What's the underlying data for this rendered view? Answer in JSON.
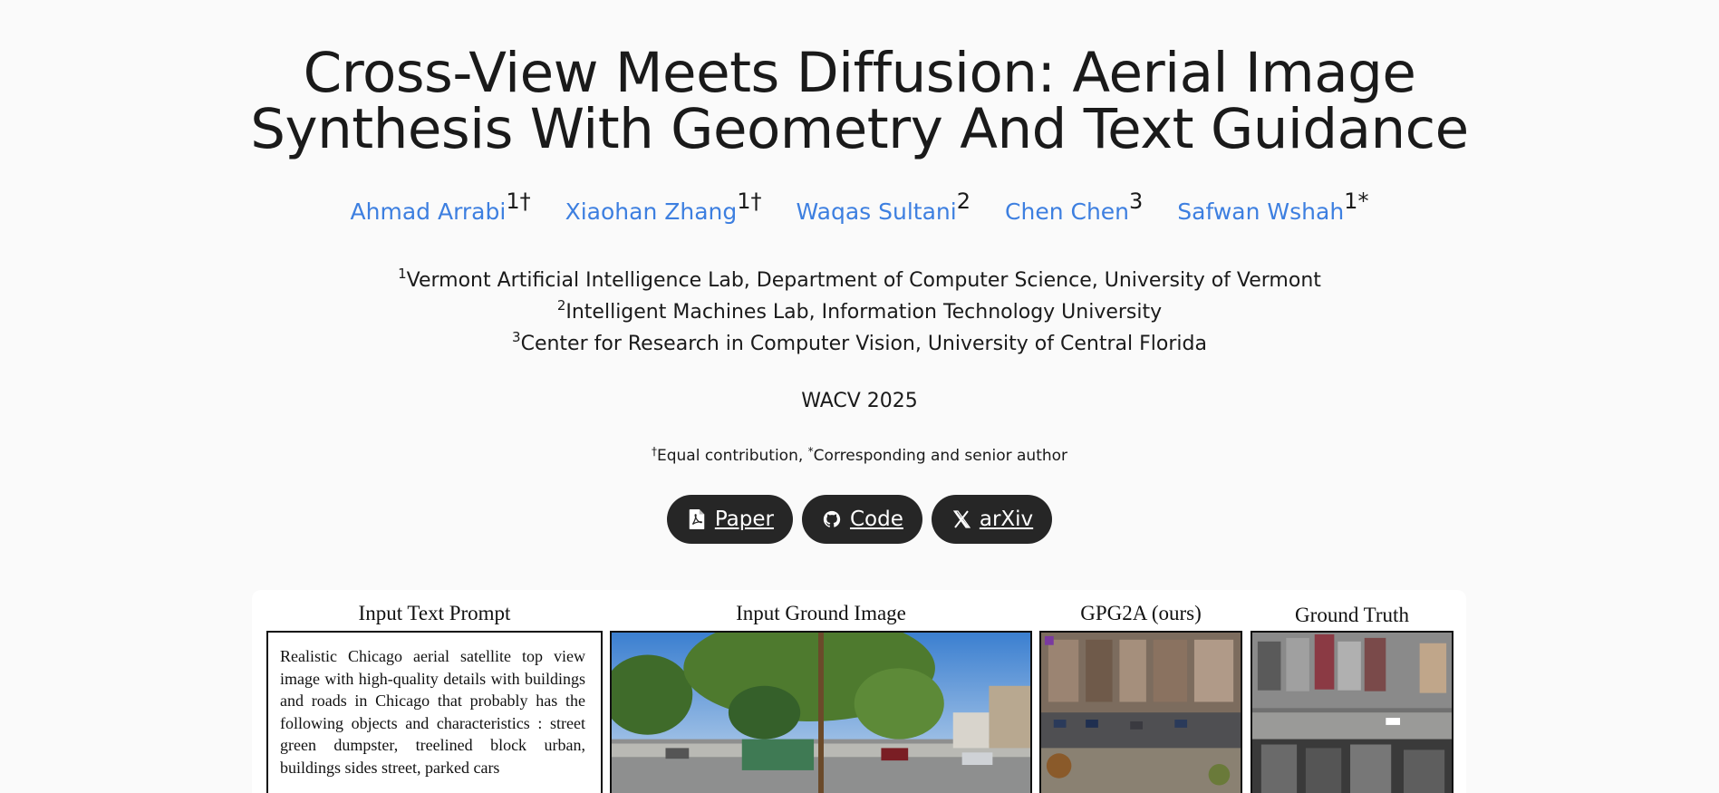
{
  "header": {
    "title_line1": "Cross-View Meets Diffusion: Aerial Image",
    "title_line2": "Synthesis With Geometry And Text Guidance"
  },
  "authors": [
    {
      "name": "Ahmad Arrabi",
      "sup": "1†"
    },
    {
      "name": "Xiaohan Zhang",
      "sup": "1†"
    },
    {
      "name": "Waqas Sultani",
      "sup": "2"
    },
    {
      "name": "Chen Chen",
      "sup": "3"
    },
    {
      "name": "Safwan Wshah",
      "sup": "1*"
    }
  ],
  "affiliations": [
    {
      "sup": "1",
      "text": "Vermont Artificial Intelligence Lab, Department of Computer Science, University of Vermont"
    },
    {
      "sup": "2",
      "text": "Intelligent Machines Lab, Information Technology University"
    },
    {
      "sup": "3",
      "text": "Center for Research in Computer Vision, University of Central Florida"
    }
  ],
  "venue": "WACV 2025",
  "note": {
    "dagger": "†",
    "equal": "Equal contribution, ",
    "star": "*",
    "corresponding": "Corresponding and senior author"
  },
  "buttons": {
    "paper": "Paper",
    "code": "Code",
    "arxiv": "arXiv",
    "paper_icon": "pdf-file-icon",
    "code_icon": "github-icon",
    "arxiv_icon": "x-icon"
  },
  "figure": {
    "col1_title": "Input Text Prompt",
    "col2_title": "Input Ground Image",
    "col3_title": "GPG2A (ours)",
    "col4_title": "Ground Truth",
    "prompt_text": "Realistic Chicago aerial satellite top view image with high-quality details with buildings and roads in Chicago that probably has the following objects and characteristics : street green dumpster, treelined block urban, buildings sides street, parked cars"
  },
  "colors": {
    "link": "#3d7fe0",
    "button_bg": "#262626",
    "page_bg": "#fafafa"
  }
}
